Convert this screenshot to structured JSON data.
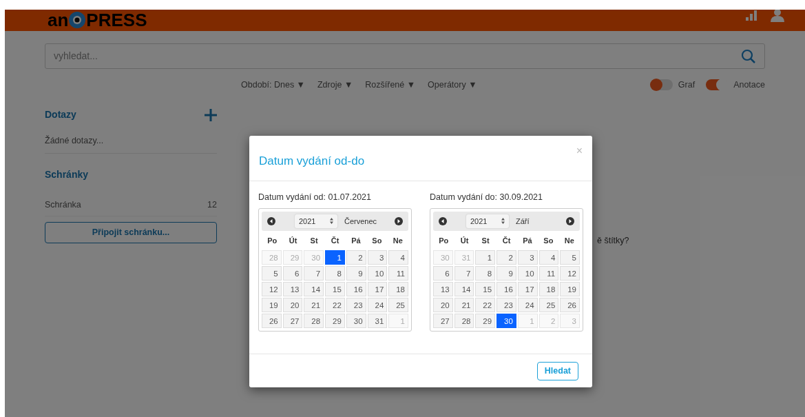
{
  "header": {
    "logo_left": "an",
    "logo_right": "PRESS"
  },
  "search": {
    "placeholder": "vyhledat..."
  },
  "filters": [
    "Období: Dnes ▼",
    "Zdroje ▼",
    "Rozšířené ▼",
    "Operátory ▼"
  ],
  "toggles": [
    {
      "label": "Graf",
      "on": false
    },
    {
      "label": "Anotace",
      "on": true
    }
  ],
  "sidebar": {
    "queries_title": "Dotazy",
    "queries_empty": "Žádné dotazy...",
    "boxes_title": "Schránky",
    "boxes": [
      {
        "name": "Schránka",
        "count": "12"
      }
    ],
    "connect_button": "Připojit schránku..."
  },
  "main": {
    "partial_text": "ě štítky?"
  },
  "dialog": {
    "title": "Datum vydání od-do",
    "close": "×",
    "search_button": "Hledat",
    "calendars": [
      {
        "label": "Datum vydání od: 01.07.2021",
        "year": "2021",
        "month": "Červenec",
        "weekdays": [
          "Po",
          "Út",
          "St",
          "Čt",
          "Pá",
          "So",
          "Ne"
        ],
        "weeks": [
          [
            {
              "day": "28",
              "muted": true,
              "selected": false
            },
            {
              "day": "29",
              "muted": true,
              "selected": false
            },
            {
              "day": "30",
              "muted": true,
              "selected": false
            },
            {
              "day": "1",
              "muted": false,
              "selected": true
            },
            {
              "day": "2",
              "muted": false,
              "selected": false
            },
            {
              "day": "3",
              "muted": false,
              "selected": false
            },
            {
              "day": "4",
              "muted": false,
              "selected": false
            }
          ],
          [
            {
              "day": "5",
              "muted": false,
              "selected": false
            },
            {
              "day": "6",
              "muted": false,
              "selected": false
            },
            {
              "day": "7",
              "muted": false,
              "selected": false
            },
            {
              "day": "8",
              "muted": false,
              "selected": false
            },
            {
              "day": "9",
              "muted": false,
              "selected": false
            },
            {
              "day": "10",
              "muted": false,
              "selected": false
            },
            {
              "day": "11",
              "muted": false,
              "selected": false
            }
          ],
          [
            {
              "day": "12",
              "muted": false,
              "selected": false
            },
            {
              "day": "13",
              "muted": false,
              "selected": false
            },
            {
              "day": "14",
              "muted": false,
              "selected": false
            },
            {
              "day": "15",
              "muted": false,
              "selected": false
            },
            {
              "day": "16",
              "muted": false,
              "selected": false
            },
            {
              "day": "17",
              "muted": false,
              "selected": false
            },
            {
              "day": "18",
              "muted": false,
              "selected": false
            }
          ],
          [
            {
              "day": "19",
              "muted": false,
              "selected": false
            },
            {
              "day": "20",
              "muted": false,
              "selected": false
            },
            {
              "day": "21",
              "muted": false,
              "selected": false
            },
            {
              "day": "22",
              "muted": false,
              "selected": false
            },
            {
              "day": "23",
              "muted": false,
              "selected": false
            },
            {
              "day": "24",
              "muted": false,
              "selected": false
            },
            {
              "day": "25",
              "muted": false,
              "selected": false
            }
          ],
          [
            {
              "day": "26",
              "muted": false,
              "selected": false
            },
            {
              "day": "27",
              "muted": false,
              "selected": false
            },
            {
              "day": "28",
              "muted": false,
              "selected": false
            },
            {
              "day": "29",
              "muted": false,
              "selected": false
            },
            {
              "day": "30",
              "muted": false,
              "selected": false
            },
            {
              "day": "31",
              "muted": false,
              "selected": false
            },
            {
              "day": "1",
              "muted": true,
              "selected": false
            }
          ]
        ]
      },
      {
        "label": "Datum vydání do: 30.09.2021",
        "year": "2021",
        "month": "Září",
        "weekdays": [
          "Po",
          "Út",
          "St",
          "Čt",
          "Pá",
          "So",
          "Ne"
        ],
        "weeks": [
          [
            {
              "day": "30",
              "muted": true,
              "selected": false
            },
            {
              "day": "31",
              "muted": true,
              "selected": false
            },
            {
              "day": "1",
              "muted": false,
              "selected": false
            },
            {
              "day": "2",
              "muted": false,
              "selected": false
            },
            {
              "day": "3",
              "muted": false,
              "selected": false
            },
            {
              "day": "4",
              "muted": false,
              "selected": false
            },
            {
              "day": "5",
              "muted": false,
              "selected": false
            }
          ],
          [
            {
              "day": "6",
              "muted": false,
              "selected": false
            },
            {
              "day": "7",
              "muted": false,
              "selected": false
            },
            {
              "day": "8",
              "muted": false,
              "selected": false
            },
            {
              "day": "9",
              "muted": false,
              "selected": false
            },
            {
              "day": "10",
              "muted": false,
              "selected": false
            },
            {
              "day": "11",
              "muted": false,
              "selected": false
            },
            {
              "day": "12",
              "muted": false,
              "selected": false
            }
          ],
          [
            {
              "day": "13",
              "muted": false,
              "selected": false
            },
            {
              "day": "14",
              "muted": false,
              "selected": false
            },
            {
              "day": "15",
              "muted": false,
              "selected": false
            },
            {
              "day": "16",
              "muted": false,
              "selected": false
            },
            {
              "day": "17",
              "muted": false,
              "selected": false
            },
            {
              "day": "18",
              "muted": false,
              "selected": false
            },
            {
              "day": "19",
              "muted": false,
              "selected": false
            }
          ],
          [
            {
              "day": "20",
              "muted": false,
              "selected": false
            },
            {
              "day": "21",
              "muted": false,
              "selected": false
            },
            {
              "day": "22",
              "muted": false,
              "selected": false
            },
            {
              "day": "23",
              "muted": false,
              "selected": false
            },
            {
              "day": "24",
              "muted": false,
              "selected": false
            },
            {
              "day": "25",
              "muted": false,
              "selected": false
            },
            {
              "day": "26",
              "muted": false,
              "selected": false
            }
          ],
          [
            {
              "day": "27",
              "muted": false,
              "selected": false
            },
            {
              "day": "28",
              "muted": false,
              "selected": false
            },
            {
              "day": "29",
              "muted": false,
              "selected": false
            },
            {
              "day": "30",
              "muted": false,
              "selected": true
            },
            {
              "day": "1",
              "muted": true,
              "selected": false
            },
            {
              "day": "2",
              "muted": true,
              "selected": false
            },
            {
              "day": "3",
              "muted": true,
              "selected": false
            }
          ]
        ]
      }
    ]
  }
}
